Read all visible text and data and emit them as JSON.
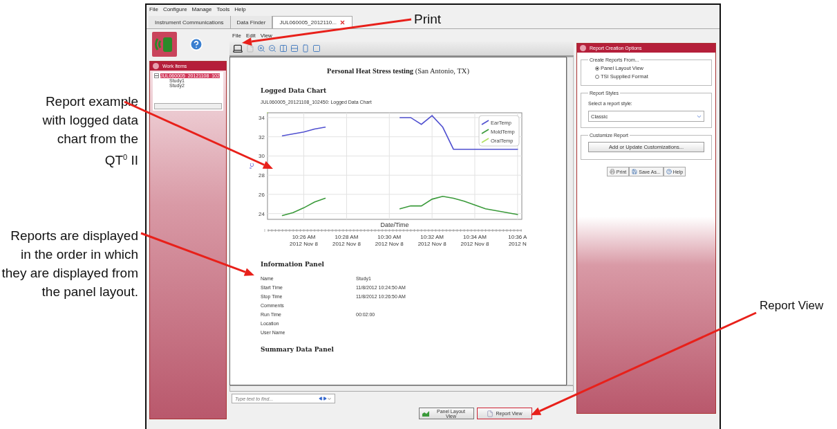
{
  "callouts": [
    {
      "text": "Report example with logged data chart from the QT$^{0}$ II"
    },
    {
      "text": "Reports are displayed in the order in which they are displayed from the panel layout."
    },
    {
      "text": "Print"
    },
    {
      "text": "Report View"
    }
  ],
  "menu_bar": [
    "File",
    "Configure",
    "Manage",
    "Tools",
    "Help"
  ],
  "tabs": [
    {
      "label": "Instrument Communications",
      "selected": false,
      "closable": false
    },
    {
      "label": "Data Finder",
      "selected": false,
      "closable": false
    },
    {
      "label": "JUL060005_2012110...",
      "selected": true,
      "closable": true
    }
  ],
  "work_items": {
    "title": "Work Items",
    "tree": [
      {
        "label": "JUL060005_20121108_102",
        "expanded": true,
        "selected": true,
        "children": [
          {
            "label": "Study1",
            "selected": false
          },
          {
            "label": "Study2",
            "selected": false
          }
        ]
      }
    ]
  },
  "viewer": {
    "menu": [
      "File",
      "Edit",
      "View"
    ],
    "report": {
      "title": "**Personal Heat Stress testing** (San Antonio, TX)",
      "sections": [
        {
          "kind": "chart",
          "heading": "Logged Data Chart",
          "caption": "JUL060005_20121108_102450: Logged Data Chart",
          "chart_data": {
            "type": "line",
            "xlabel": "Date/Time",
            "ylabel": "°C",
            "categories": [
              null,
              null,
              null,
              "10:26 AM\n2012 Nov 8",
              null,
              null,
              null,
              "10:28 AM\n2012 Nov 8",
              null,
              null,
              null,
              "10:30 AM\n2012 Nov 8",
              null,
              null,
              null,
              "10:32 AM\n2012 Nov 8",
              null,
              null,
              null,
              "10:34 AM\n2012 Nov 8",
              null,
              null,
              null,
              "10:36 A\n2012 N"
            ],
            "series": [
              {
                "name": "EarTemp",
                "color": "#5050d0",
                "values": [
                  null,
                  32.1,
                  32.3,
                  32.5,
                  32.8,
                  33.0,
                  null,
                  null,
                  null,
                  null,
                  null,
                  null,
                  34.0,
                  34.0,
                  33.3,
                  34.2,
                  33.0,
                  30.7,
                  30.7,
                  30.7,
                  30.7,
                  30.7,
                  30.7,
                  30.7
                ]
              },
              {
                "name": "MoldTemp",
                "color": "#3a9a3a",
                "values": [
                  null,
                  23.8,
                  24.1,
                  24.6,
                  25.2,
                  25.6,
                  null,
                  null,
                  null,
                  null,
                  null,
                  null,
                  24.5,
                  24.8,
                  24.8,
                  25.5,
                  25.8,
                  25.6,
                  25.3,
                  24.9,
                  24.5,
                  24.3,
                  24.1,
                  23.9
                ]
              },
              {
                "name": "OralTemp",
                "color": "#b0e060",
                "values": [
                  null,
                  null,
                  null,
                  null,
                  null,
                  null,
                  null,
                  null,
                  null,
                  null,
                  null,
                  null,
                  null,
                  null,
                  null,
                  null,
                  null,
                  null,
                  null,
                  null,
                  null,
                  null,
                  null,
                  null
                ]
              }
            ],
            "ylim": [
              23.4,
              34.5
            ],
            "yticks": [
              24,
              26,
              28,
              30,
              32,
              34
            ],
            "grid": true,
            "legend": "upper right"
          }
        },
        {
          "kind": "info",
          "heading": "Information Panel",
          "rows": [
            {
              "label": "Name",
              "value": "Study1"
            },
            {
              "label": "Start Time",
              "value": "11/8/2012 10:24:50 AM"
            },
            {
              "label": "Stop Time",
              "value": "11/8/2012 10:26:50 AM"
            },
            {
              "label": "Comments"
            },
            {
              "label": "Run Time",
              "value": "00:02:00"
            },
            {
              "label": "Location"
            },
            {
              "label": "User Name"
            }
          ]
        },
        {
          "kind": "heading",
          "heading": "Summary Data Panel"
        }
      ]
    },
    "find": {
      "placeholder": "Type text to find..."
    }
  },
  "view_buttons": [
    {
      "label": "Panel Layout View",
      "selected": false
    },
    {
      "label": "Report View",
      "selected": true
    }
  ],
  "options": {
    "title": "Report Creation Options",
    "create_from": {
      "legend": "Create Reports From...",
      "options": [
        {
          "label": "Panel Layout View",
          "selected": true
        },
        {
          "label": "TSI Supplied Format",
          "selected": false
        }
      ]
    },
    "styles": {
      "legend": "Report Styles",
      "prompt": "Select a report style:",
      "value": "Classic"
    },
    "customize": {
      "legend": "Customize Report",
      "button": "Add or Update Customizations..."
    },
    "actions": [
      "Print",
      "Save As...",
      "Help"
    ]
  }
}
